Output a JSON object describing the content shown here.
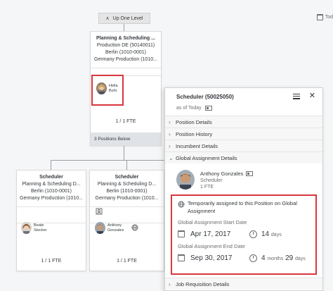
{
  "toolbar": {
    "up_one_level": "Up One Level",
    "top_right_text": "Tod"
  },
  "top_card": {
    "title": "Planning & Scheduling ...",
    "line1": "Production DE (50140011)",
    "line2": "Berlin (1010-0001)",
    "line3": "Germany Production (1010...",
    "person_first": "Hella",
    "person_last": "Buhr",
    "fte": "1 / 1 FTE",
    "positions_below": "3 Positions Below"
  },
  "child_cards": [
    {
      "title": "Scheduler",
      "line1": "Planning & Scheduling D...",
      "line2": "Berlin (1010-0001)",
      "line3": "Germany Production (1010...",
      "person_first": "Beate",
      "person_last": "Stocker",
      "fte": "1 / 1 FTE"
    },
    {
      "title": "Scheduler",
      "line1": "Planning & Scheduling D...",
      "line2": "Berlin (1010-0001)",
      "line3": "Germany Production (1010...",
      "person_first": "Anthony",
      "person_last": "Gonzales",
      "fte": "1 / 1 FTE"
    }
  ],
  "panel": {
    "title": "Scheduler (50025050)",
    "as_of": "as of Today",
    "sections": [
      "Position Details",
      "Position History",
      "Incumbent Details",
      "Global Assignment Details"
    ],
    "footer_section": "Job Requisition Details",
    "ga": {
      "name": "Anthony Gonzales",
      "job": "Scheduler",
      "fte": "1 FTE",
      "notice": "Temporarily assigned to this Position on Global Assignment",
      "start_label": "Global Assignment Start Date",
      "start_date": "Apr 17, 2017",
      "start_duration_num": "14",
      "start_duration_unit": "days",
      "end_label": "Global Assignment End Date",
      "end_date": "Sep 30, 2017",
      "end_duration_num1": "4",
      "end_duration_unit1": "months",
      "end_duration_num2": "29",
      "end_duration_unit2": "days"
    }
  },
  "colors": {
    "highlight": "#d9363e",
    "bar": "#dfe3e7"
  }
}
